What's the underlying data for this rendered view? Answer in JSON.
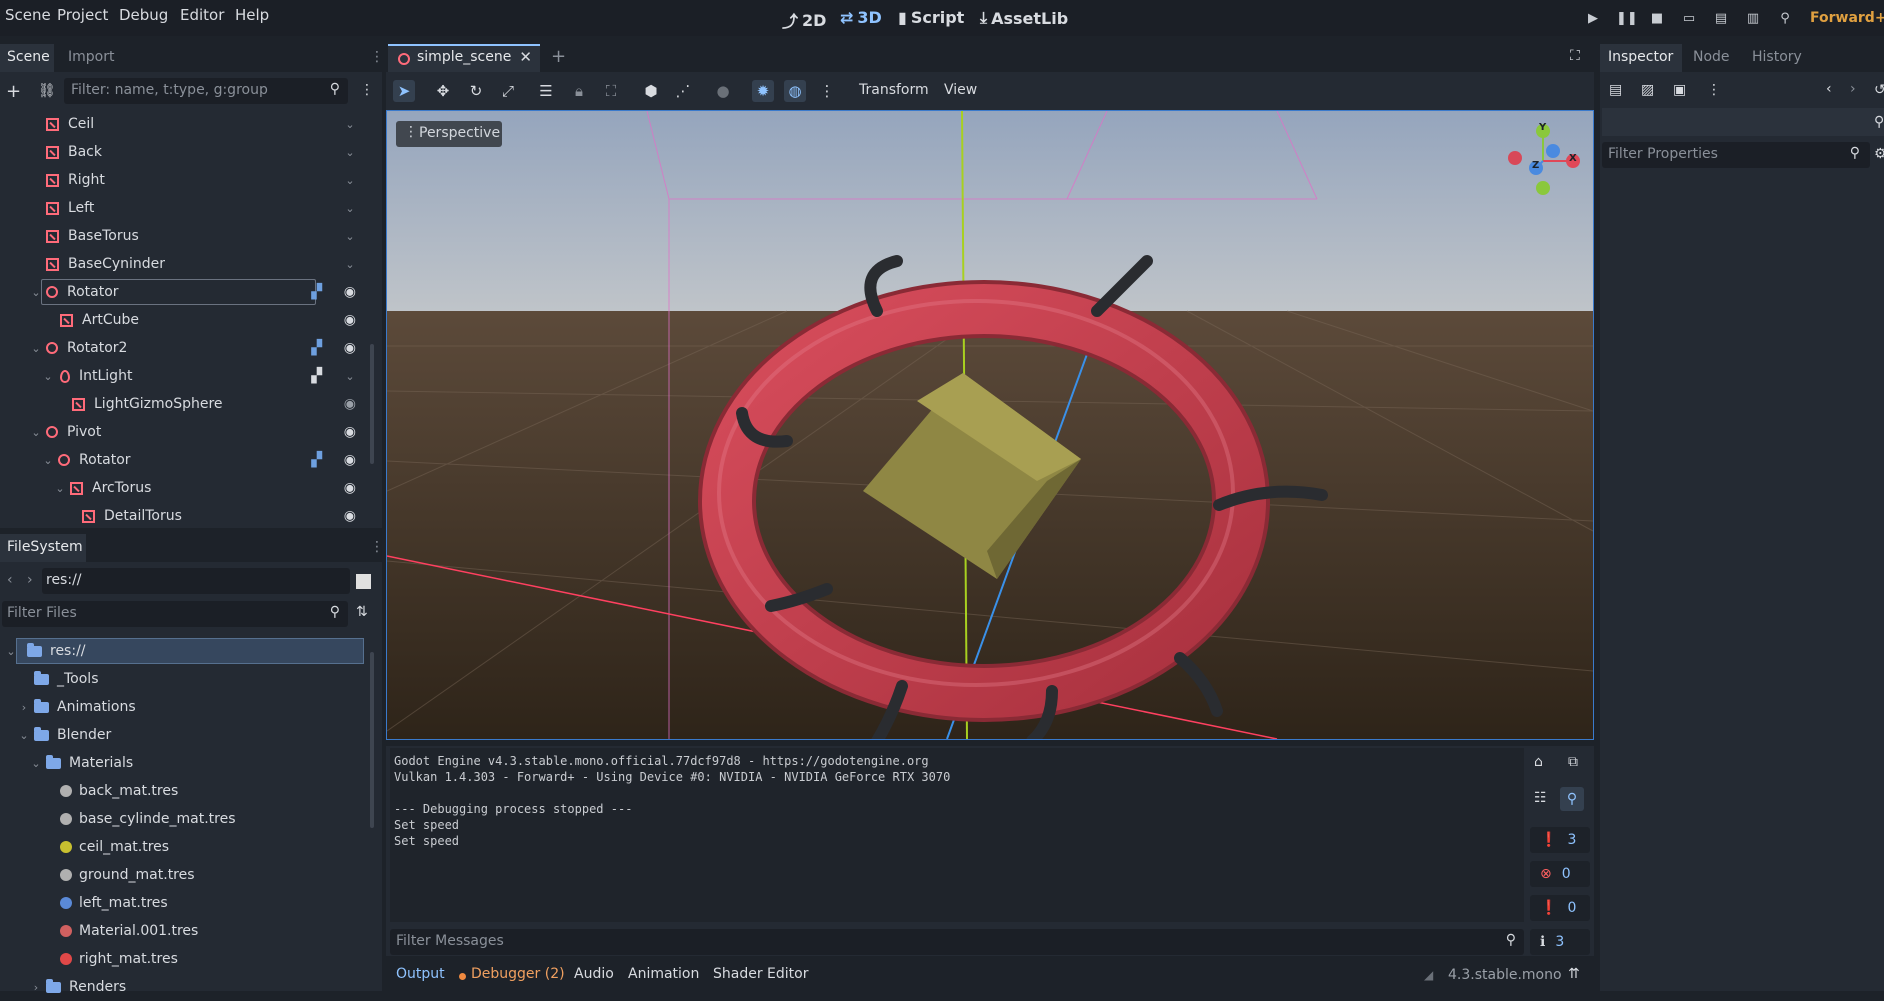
{
  "menubar": {
    "items": [
      "Scene",
      "Project",
      "Debug",
      "Editor",
      "Help"
    ],
    "workspaces": [
      {
        "label": "2D",
        "icon": "2d-icon",
        "active": false
      },
      {
        "label": "3D",
        "icon": "3d-icon",
        "active": true
      },
      {
        "label": "Script",
        "icon": "script-icon",
        "active": false
      },
      {
        "label": "AssetLib",
        "icon": "assetlib-icon",
        "active": false
      }
    ],
    "renderer": "Forward+"
  },
  "scene_dock": {
    "tabs": [
      "Scene",
      "Import"
    ],
    "filter_placeholder": "Filter: name, t:type, g:group",
    "tree": [
      {
        "label": "Ceil",
        "icon": "mesh-icon"
      },
      {
        "label": "Back",
        "icon": "mesh-icon"
      },
      {
        "label": "Right",
        "icon": "mesh-icon"
      },
      {
        "label": "Left",
        "icon": "mesh-icon"
      },
      {
        "label": "BaseTorus",
        "icon": "mesh-icon"
      },
      {
        "label": "BaseCyninder",
        "icon": "mesh-icon"
      },
      {
        "label": "Rotator",
        "icon": "node3d-icon"
      },
      {
        "label": "ArtCube",
        "icon": "mesh-icon"
      },
      {
        "label": "Rotator2",
        "icon": "node3d-icon"
      },
      {
        "label": "IntLight",
        "icon": "light-icon"
      },
      {
        "label": "LightGizmoSphere",
        "icon": "mesh-icon"
      },
      {
        "label": "Pivot",
        "icon": "node3d-icon"
      },
      {
        "label": "Rotator",
        "icon": "node3d-icon"
      },
      {
        "label": "ArcTorus",
        "icon": "mesh-icon"
      },
      {
        "label": "DetailTorus",
        "icon": "mesh-icon"
      }
    ]
  },
  "filesystem": {
    "tab": "FileSystem",
    "path": "res://",
    "filter_placeholder": "Filter Files",
    "items": [
      {
        "label": "res://",
        "type": "folder"
      },
      {
        "label": "_Tools",
        "type": "folder"
      },
      {
        "label": "Animations",
        "type": "folder"
      },
      {
        "label": "Blender",
        "type": "folder"
      },
      {
        "label": "Materials",
        "type": "folder"
      },
      {
        "label": "back_mat.tres",
        "type": "material",
        "color": "#b0b0b0"
      },
      {
        "label": "base_cylinde_mat.tres",
        "type": "material",
        "color": "#b0b0b0"
      },
      {
        "label": "ceil_mat.tres",
        "type": "material",
        "color": "#c8c030"
      },
      {
        "label": "ground_mat.tres",
        "type": "material",
        "color": "#b0b0b0"
      },
      {
        "label": "left_mat.tres",
        "type": "material",
        "color": "#5a8ad8"
      },
      {
        "label": "Material.001.tres",
        "type": "material",
        "color": "#d06060"
      },
      {
        "label": "right_mat.tres",
        "type": "material",
        "color": "#e04848"
      },
      {
        "label": "Renders",
        "type": "folder"
      }
    ]
  },
  "editor": {
    "scene_tab": "simple_scene",
    "toolbar": {
      "transform": "Transform",
      "view": "View"
    },
    "viewport_label": "Perspective",
    "gizmo": {
      "y": "Y",
      "x": "X",
      "z": "Z"
    }
  },
  "inspector": {
    "tabs": [
      "Inspector",
      "Node",
      "History"
    ],
    "filter_placeholder": "Filter Properties"
  },
  "output": {
    "lines": [
      "Godot Engine v4.3.stable.mono.official.77dcf97d8 - https://godotengine.org",
      "Vulkan 1.4.303 - Forward+ - Using Device #0: NVIDIA - NVIDIA GeForce RTX 3070",
      "",
      "--- Debugging process stopped ---",
      "Set speed",
      "Set speed"
    ],
    "filter_placeholder": "Filter Messages",
    "counters": {
      "messages": "3",
      "errors": "0",
      "warnings": "0",
      "info": "3"
    }
  },
  "bottom_panel": {
    "tabs": [
      "Output",
      "Debugger (2)",
      "Audio",
      "Animation",
      "Shader Editor"
    ],
    "version": "4.3.stable.mono"
  },
  "colors": {
    "accent": "#8fc3ff",
    "mesh_icon": "#ff6b7a",
    "torus": "#c9404e",
    "cube": "#8a8040",
    "debugger_dot": "#f08a40"
  }
}
